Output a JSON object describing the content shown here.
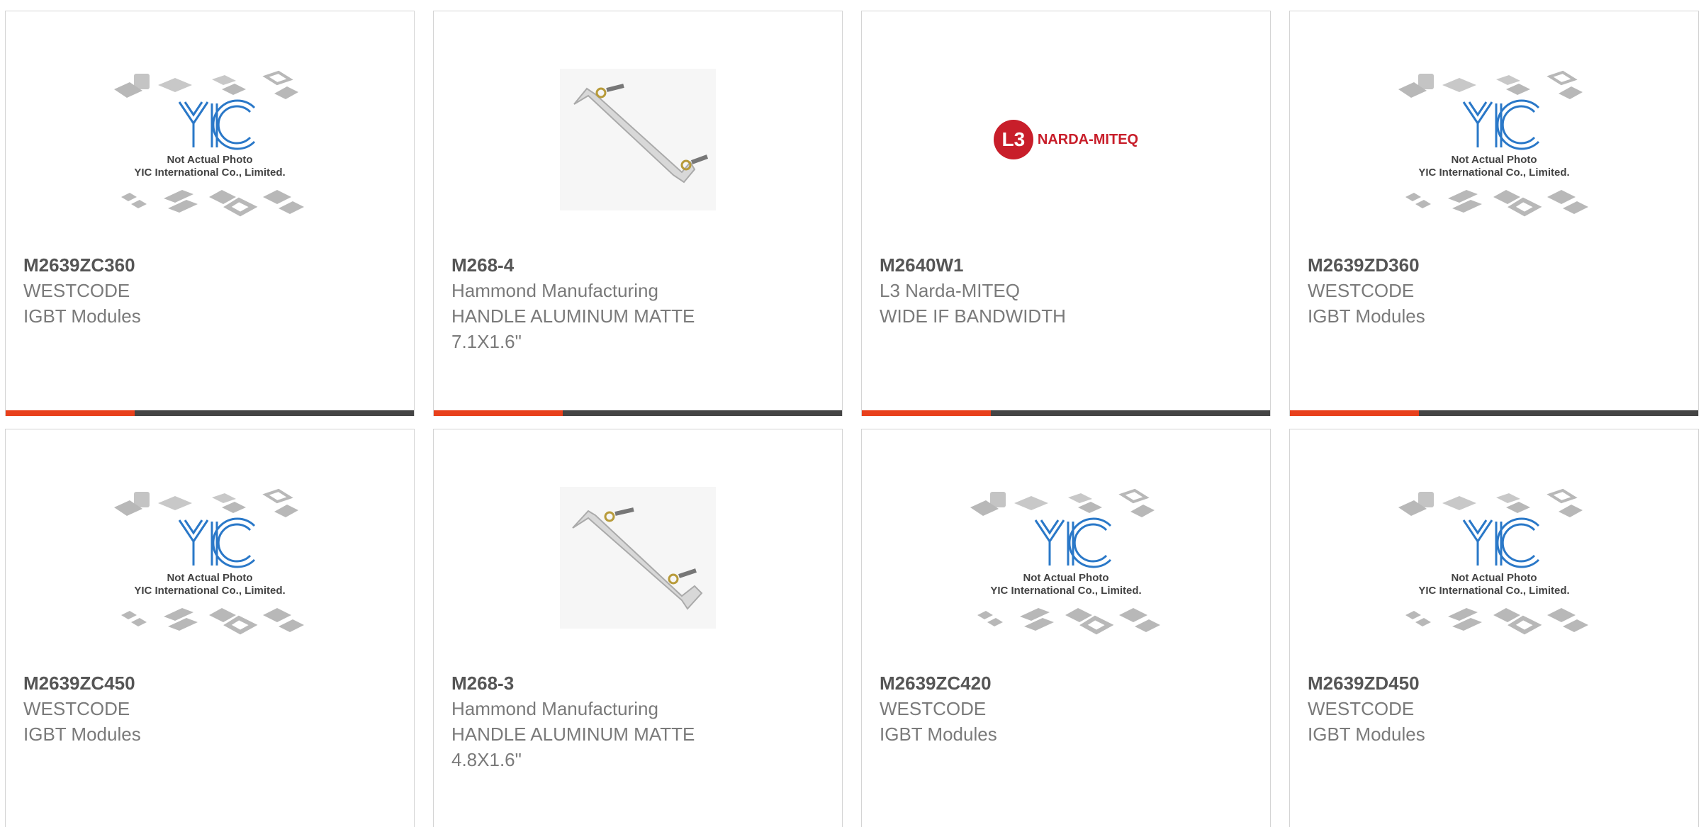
{
  "colors": {
    "accent": "#e8401c",
    "bar": "#444444",
    "border": "#d4d4d4"
  },
  "products": [
    {
      "part": "M2639ZC360",
      "maker": "WESTCODE",
      "desc": [
        "IGBT Modules"
      ],
      "image": "yic-placeholder"
    },
    {
      "part": "M268-4",
      "maker": "Hammond Manufacturing",
      "desc": [
        "HANDLE ALUMINUM MATTE",
        "7.1X1.6\""
      ],
      "image": "handle-photo"
    },
    {
      "part": "M2640W1",
      "maker": "L3 Narda-MITEQ",
      "desc": [
        "WIDE IF BANDWIDTH"
      ],
      "image": "narda-logo"
    },
    {
      "part": "M2639ZD360",
      "maker": "WESTCODE",
      "desc": [
        "IGBT Modules"
      ],
      "image": "yic-placeholder"
    },
    {
      "part": "M2639ZC450",
      "maker": "WESTCODE",
      "desc": [
        "IGBT Modules"
      ],
      "image": "yic-placeholder"
    },
    {
      "part": "M268-3",
      "maker": "Hammond Manufacturing",
      "desc": [
        "HANDLE ALUMINUM MATTE",
        "4.8X1.6\""
      ],
      "image": "handle-photo"
    },
    {
      "part": "M2639ZC420",
      "maker": "WESTCODE",
      "desc": [
        "IGBT Modules"
      ],
      "image": "yic-placeholder"
    },
    {
      "part": "M2639ZD450",
      "maker": "WESTCODE",
      "desc": [
        "IGBT Modules"
      ],
      "image": "yic-placeholder"
    }
  ],
  "placeholder": {
    "line1": "Not Actual Photo",
    "line2": "YIC International Co., Limited.",
    "logo_text": "YIC"
  },
  "narda_logo": {
    "mark": "L3",
    "text": "NARDA-MITEQ"
  }
}
